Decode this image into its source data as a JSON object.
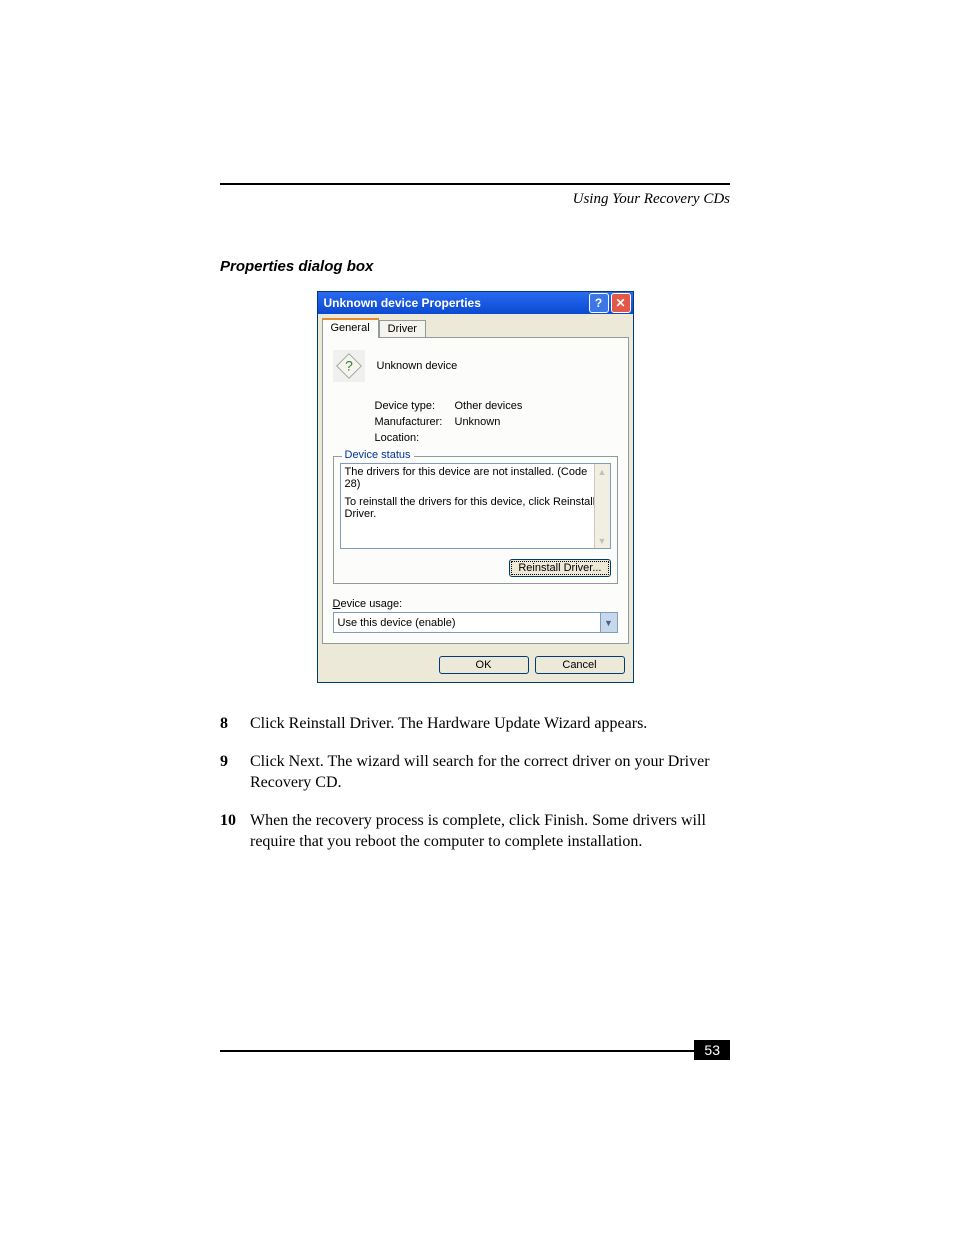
{
  "header": {
    "running": "Using Your Recovery CDs"
  },
  "caption": "Properties dialog box",
  "dialog": {
    "title": "Unknown device Properties",
    "help_glyph": "?",
    "close_glyph": "✕",
    "tabs": {
      "general": "General",
      "driver": "Driver"
    },
    "device_name": "Unknown device",
    "rows": {
      "type_label": "Device type:",
      "type_value": "Other devices",
      "mfr_label": "Manufacturer:",
      "mfr_value": "Unknown",
      "loc_label": "Location:",
      "loc_value": ""
    },
    "status_legend": "Device status",
    "status_line1": "The drivers for this device are not installed. (Code 28)",
    "status_line2": "To reinstall the drivers for this device, click Reinstall Driver.",
    "reinstall_btn": "Reinstall Driver...",
    "usage_prefix": "D",
    "usage_rest": "evice usage:",
    "usage_value": "Use this device (enable)",
    "ok": "OK",
    "cancel": "Cancel"
  },
  "steps": {
    "s8": {
      "num": "8",
      "text": "Click Reinstall Driver. The Hardware Update Wizard appears."
    },
    "s9": {
      "num": "9",
      "text": "Click Next. The wizard will search for the correct driver on your Driver Recovery CD."
    },
    "s10": {
      "num": "10",
      "text": "When the recovery process is complete, click Finish. Some drivers will require that you reboot the computer to complete installation."
    }
  },
  "page_number": "53"
}
